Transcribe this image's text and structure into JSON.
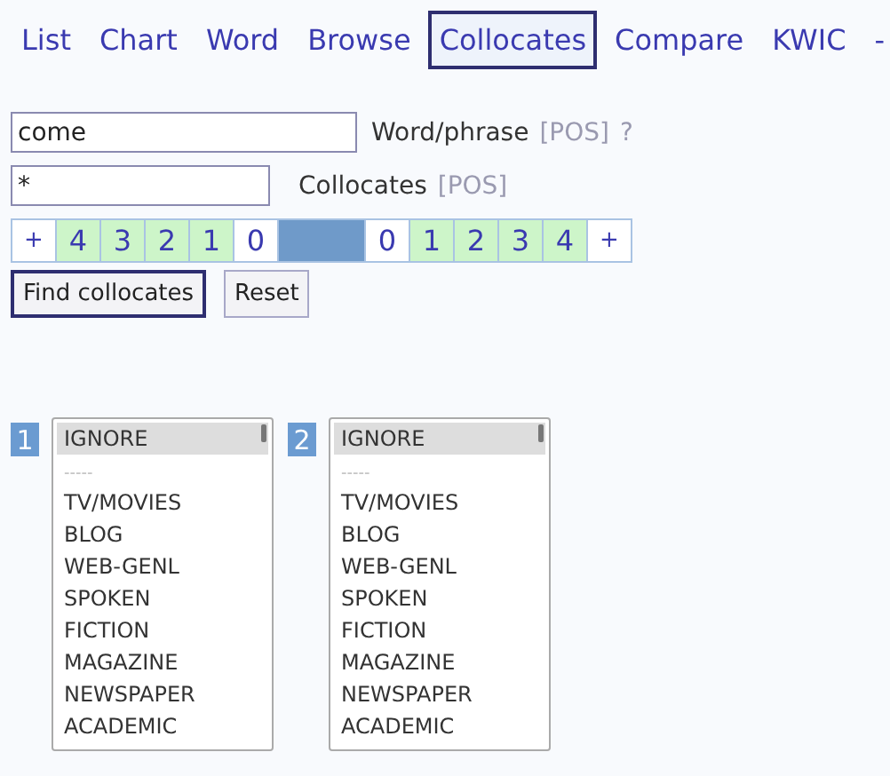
{
  "nav": [
    {
      "label": "List",
      "selected": false
    },
    {
      "label": "Chart",
      "selected": false
    },
    {
      "label": "Word",
      "selected": false
    },
    {
      "label": "Browse",
      "selected": false
    },
    {
      "label": "Collocates",
      "selected": true
    },
    {
      "label": "Compare",
      "selected": false
    },
    {
      "label": "KWIC",
      "selected": false
    },
    {
      "label": "-",
      "selected": false
    }
  ],
  "word_field": {
    "value": "come",
    "label": "Word/phrase",
    "pos": "[POS]",
    "help": "?"
  },
  "collocates_field": {
    "value": "*",
    "label": "Collocates",
    "pos": "[POS]"
  },
  "span": [
    {
      "kind": "plus",
      "text": "+"
    },
    {
      "kind": "num",
      "text": "4",
      "selected": true
    },
    {
      "kind": "num",
      "text": "3",
      "selected": true
    },
    {
      "kind": "num",
      "text": "2",
      "selected": true
    },
    {
      "kind": "num",
      "text": "1",
      "selected": true
    },
    {
      "kind": "num",
      "text": "0",
      "selected": false
    },
    {
      "kind": "node"
    },
    {
      "kind": "num",
      "text": "0",
      "selected": false
    },
    {
      "kind": "num",
      "text": "1",
      "selected": true
    },
    {
      "kind": "num",
      "text": "2",
      "selected": true
    },
    {
      "kind": "num",
      "text": "3",
      "selected": true
    },
    {
      "kind": "num",
      "text": "4",
      "selected": true
    },
    {
      "kind": "plus",
      "text": "+"
    }
  ],
  "buttons": [
    {
      "label": "Find collocates",
      "focused": true
    },
    {
      "label": "Reset",
      "focused": false
    }
  ],
  "sections": [
    {
      "number": "1",
      "items": [
        {
          "text": "IGNORE",
          "selected": true
        },
        {
          "text": "-----",
          "selected": false
        },
        {
          "text": "TV/MOVIES",
          "selected": false
        },
        {
          "text": "BLOG",
          "selected": false
        },
        {
          "text": "WEB-GENL",
          "selected": false
        },
        {
          "text": "SPOKEN",
          "selected": false
        },
        {
          "text": "FICTION",
          "selected": false
        },
        {
          "text": "MAGAZINE",
          "selected": false
        },
        {
          "text": "NEWSPAPER",
          "selected": false
        },
        {
          "text": "ACADEMIC",
          "selected": false
        }
      ]
    },
    {
      "number": "2",
      "items": [
        {
          "text": "IGNORE",
          "selected": true
        },
        {
          "text": "-----",
          "selected": false
        },
        {
          "text": "TV/MOVIES",
          "selected": false
        },
        {
          "text": "BLOG",
          "selected": false
        },
        {
          "text": "WEB-GENL",
          "selected": false
        },
        {
          "text": "SPOKEN",
          "selected": false
        },
        {
          "text": "FICTION",
          "selected": false
        },
        {
          "text": "MAGAZINE",
          "selected": false
        },
        {
          "text": "NEWSPAPER",
          "selected": false
        },
        {
          "text": "ACADEMIC",
          "selected": false
        }
      ]
    }
  ]
}
